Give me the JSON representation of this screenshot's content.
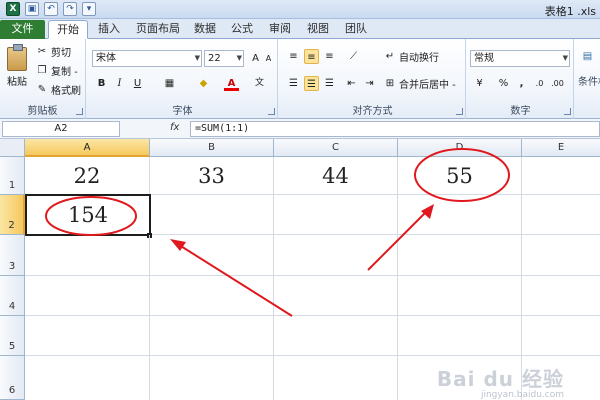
{
  "window": {
    "title": "表格1 .xls"
  },
  "ribbon_tabs": [
    "文件",
    "开始",
    "插入",
    "页面布局",
    "数据",
    "公式",
    "审阅",
    "视图",
    "团队"
  ],
  "clipboard": {
    "paste": "粘贴",
    "cut": "剪切",
    "copy": "复制 -",
    "format_painter": "格式刷",
    "group": "剪贴板"
  },
  "font": {
    "name": "宋体",
    "size": "22",
    "bold": "B",
    "italic": "I",
    "underline": "U",
    "group": "字体"
  },
  "alignment": {
    "wrap": "自动换行",
    "merge": "合并后居中 -",
    "group": "对齐方式"
  },
  "number": {
    "format": "常规",
    "percent": "%",
    "comma": ",",
    "group": "数字"
  },
  "styles": {
    "conditional": "条件格"
  },
  "formula_bar": {
    "name_box": "A2",
    "fx": "fx",
    "formula": "=SUM(1:1)"
  },
  "columns": [
    "A",
    "B",
    "C",
    "D",
    "E"
  ],
  "rows": [
    "1",
    "2",
    "3",
    "4",
    "5",
    "6"
  ],
  "cells": {
    "A1": "22",
    "B1": "33",
    "C1": "44",
    "D1": "55",
    "A2": "154"
  },
  "colors": {
    "annotation": "#e0191e",
    "selection_header": "#f6c85f",
    "file_tab": "#2e7d32"
  },
  "watermark": {
    "main": "Bai du 经验",
    "sub": "jingyan.baidu.com"
  }
}
